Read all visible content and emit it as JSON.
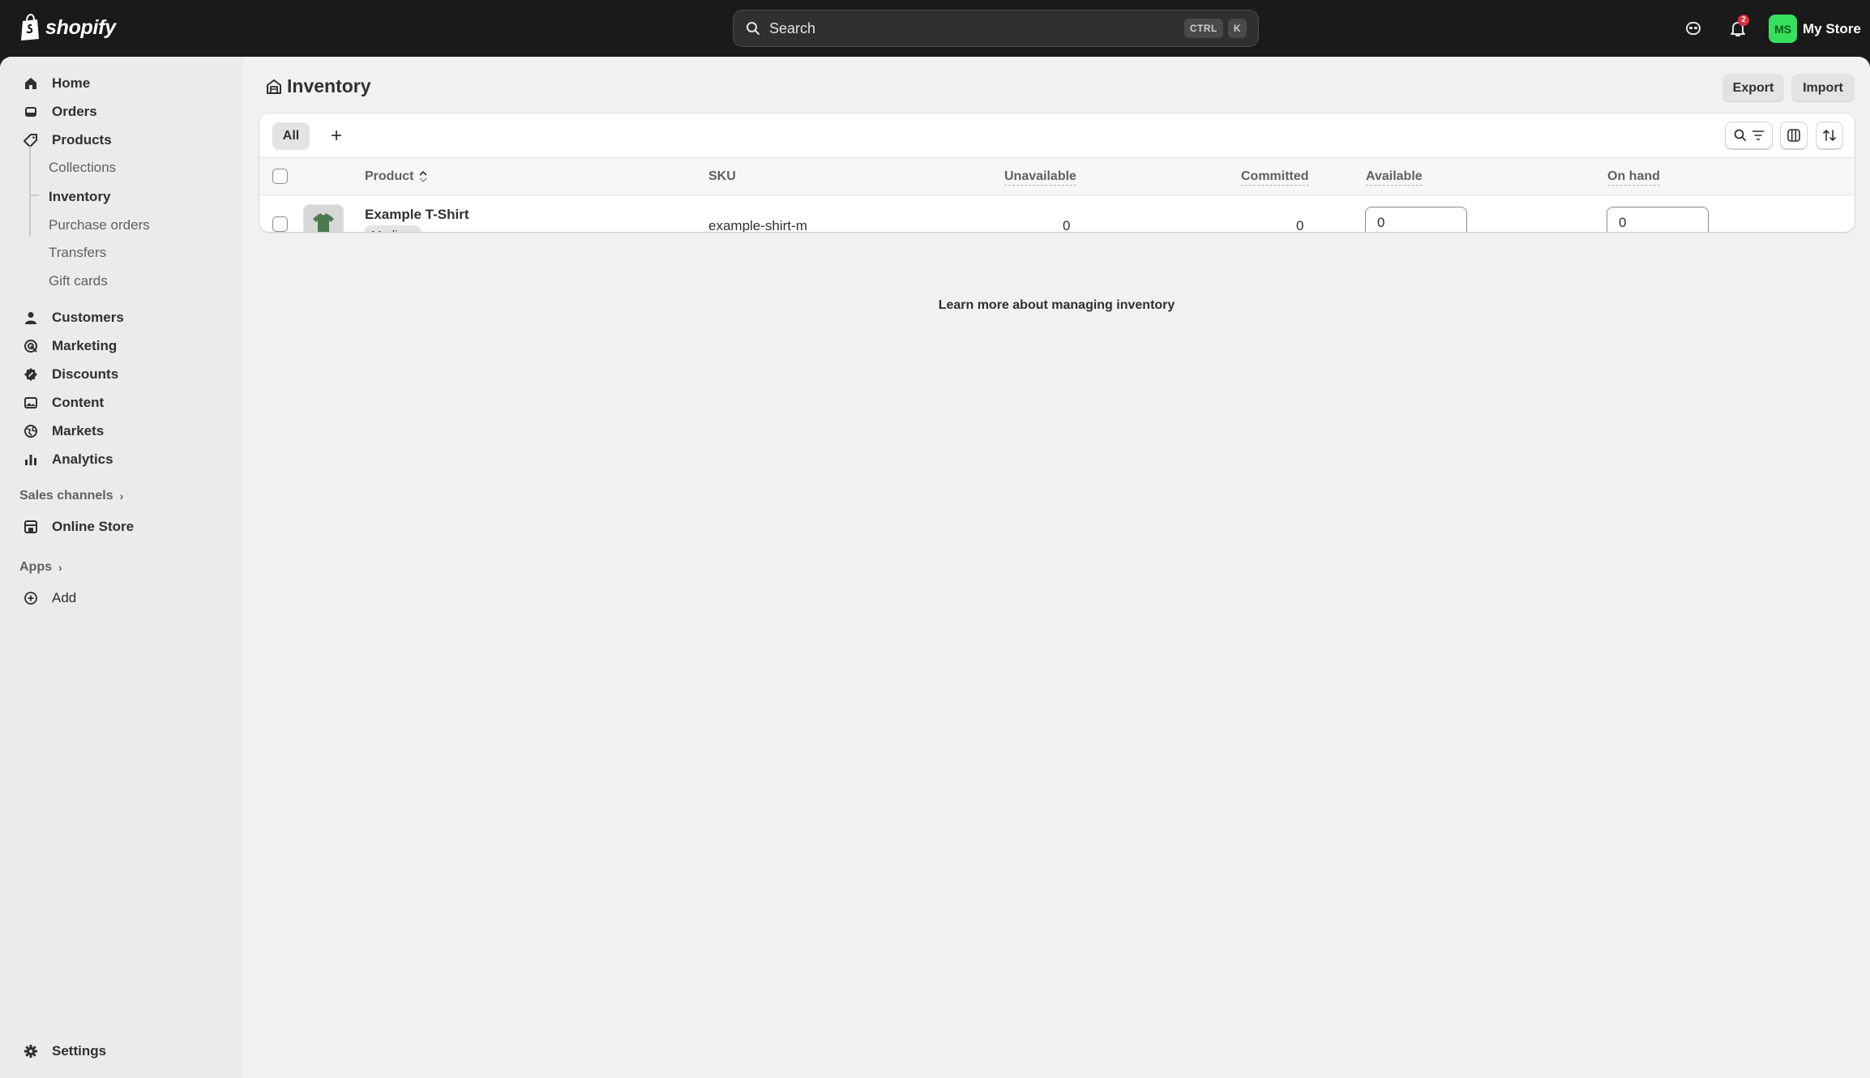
{
  "topbar": {
    "brand": "shopify",
    "search_placeholder": "Search",
    "shortcut_keys": [
      "CTRL",
      "K"
    ],
    "notification_count": "2",
    "store_initials": "MS",
    "store_name": "My Store",
    "avatar_color": "#36e05c"
  },
  "sidebar": {
    "items": [
      {
        "label": "Home",
        "icon": "home-icon"
      },
      {
        "label": "Orders",
        "icon": "inbox-icon"
      },
      {
        "label": "Products",
        "icon": "tag-icon"
      },
      {
        "label": "Customers",
        "icon": "person-icon"
      },
      {
        "label": "Marketing",
        "icon": "target-icon"
      },
      {
        "label": "Discounts",
        "icon": "discount-icon"
      },
      {
        "label": "Content",
        "icon": "image-icon"
      },
      {
        "label": "Markets",
        "icon": "globe-icon"
      },
      {
        "label": "Analytics",
        "icon": "bar-chart-icon"
      }
    ],
    "product_subitems": [
      "Collections",
      "Inventory",
      "Purchase orders",
      "Transfers",
      "Gift cards"
    ],
    "active_subitem": "Inventory",
    "sales_channels_label": "Sales channels",
    "online_store_label": "Online Store",
    "apps_label": "Apps",
    "add_label": "Add",
    "settings_label": "Settings"
  },
  "page": {
    "title": "Inventory",
    "export_label": "Export",
    "import_label": "Import",
    "tabs": {
      "all_label": "All",
      "add_label": "+"
    }
  },
  "table": {
    "columns": [
      "Product",
      "SKU",
      "Unavailable",
      "Committed",
      "Available",
      "On hand"
    ],
    "rows": [
      {
        "product": "Example T-Shirt",
        "variant": "Medium",
        "sku": "example-shirt-m",
        "unavailable": "0",
        "committed": "0",
        "available": "0",
        "on_hand": "0"
      }
    ]
  },
  "footer_link": "Learn more about managing inventory"
}
